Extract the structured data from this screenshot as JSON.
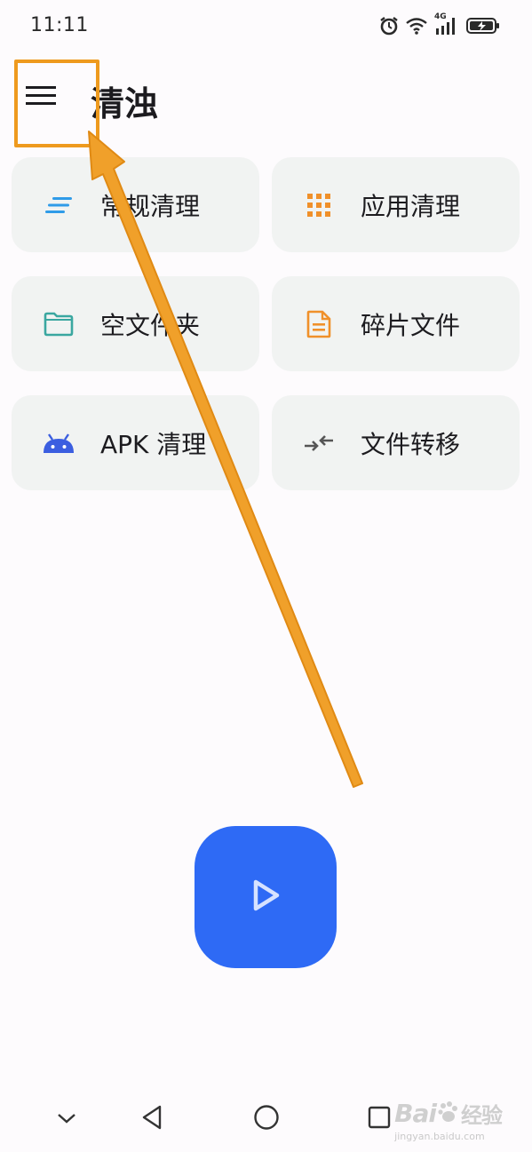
{
  "status_bar": {
    "time": "11:11",
    "network": "4G",
    "icons": [
      "alarm-icon",
      "wifi-icon",
      "signal-4g-icon",
      "battery-charging-icon"
    ]
  },
  "header": {
    "title": "清浊",
    "menu_icon": "hamburger-menu-icon"
  },
  "cards": [
    {
      "label": "常规清理",
      "icon": "clean-lines-icon",
      "color": "#2f9be8"
    },
    {
      "label": "应用清理",
      "icon": "app-grid-icon",
      "color": "#f0902a"
    },
    {
      "label": "空文件夹",
      "icon": "folder-icon",
      "color": "#3aa7a0"
    },
    {
      "label": "碎片文件",
      "icon": "document-icon",
      "color": "#f0902a"
    },
    {
      "label": "APK 清理",
      "icon": "android-icon",
      "color": "#3b5ee0"
    },
    {
      "label": "文件转移",
      "icon": "transfer-arrows-icon",
      "color": "#555555"
    }
  ],
  "fab": {
    "icon": "play-icon",
    "color": "#2e6af5"
  },
  "nav_bar": {
    "buttons": [
      "chevron-down-icon",
      "back-triangle-icon",
      "home-circle-icon",
      "recents-square-icon"
    ]
  },
  "annotation": {
    "color": "#ee9a1e"
  },
  "watermark": {
    "brand": "Bai",
    "brand2": "经验",
    "sub": "jingyan.baidu.com"
  }
}
